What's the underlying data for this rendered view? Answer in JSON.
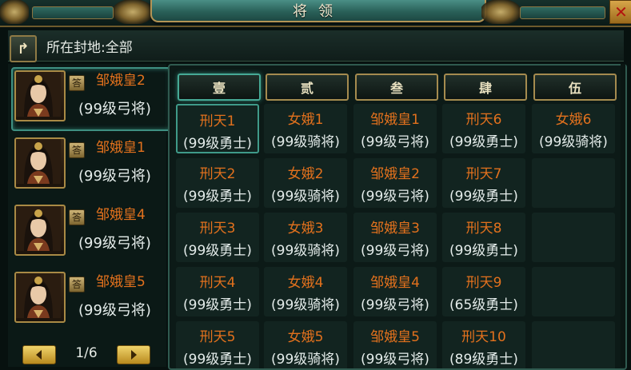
{
  "header": {
    "title": "将领"
  },
  "filter": {
    "label": "所在封地:全部"
  },
  "left_list": {
    "heroes": [
      {
        "name": "邹娥皇2",
        "level": "(99级弓将)",
        "badge": "答",
        "selected": true
      },
      {
        "name": "邹娥皇1",
        "level": "(99级弓将)",
        "badge": "答",
        "selected": false
      },
      {
        "name": "邹娥皇4",
        "level": "(99级弓将)",
        "badge": "答",
        "selected": false
      },
      {
        "name": "邹娥皇5",
        "level": "(99级弓将)",
        "badge": "答",
        "selected": false
      }
    ],
    "pager": {
      "text": "1/6"
    }
  },
  "grid": {
    "columns": [
      "壹",
      "贰",
      "叁",
      "肆",
      "伍"
    ],
    "active_column": 0,
    "rows": [
      [
        {
          "name": "刑天1",
          "level": "(99级勇士)"
        },
        {
          "name": "女娥1",
          "level": "(99级骑将)"
        },
        {
          "name": "邹娥皇1",
          "level": "(99级弓将)"
        },
        {
          "name": "刑天6",
          "level": "(99级勇士)"
        },
        {
          "name": "女娥6",
          "level": "(99级骑将)"
        }
      ],
      [
        {
          "name": "刑天2",
          "level": "(99级勇士)"
        },
        {
          "name": "女娥2",
          "level": "(99级骑将)"
        },
        {
          "name": "邹娥皇2",
          "level": "(99级弓将)"
        },
        {
          "name": "刑天7",
          "level": "(99级勇士)"
        },
        {
          "name": "",
          "level": ""
        }
      ],
      [
        {
          "name": "刑天3",
          "level": "(99级勇士)"
        },
        {
          "name": "女娥3",
          "level": "(99级骑将)"
        },
        {
          "name": "邹娥皇3",
          "level": "(99级弓将)"
        },
        {
          "name": "刑天8",
          "level": "(99级勇士)"
        },
        {
          "name": "",
          "level": ""
        }
      ],
      [
        {
          "name": "刑天4",
          "level": "(99级勇士)"
        },
        {
          "name": "女娥4",
          "level": "(99级骑将)"
        },
        {
          "name": "邹娥皇4",
          "level": "(99级弓将)"
        },
        {
          "name": "刑天9",
          "level": "(65级勇士)"
        },
        {
          "name": "",
          "level": ""
        }
      ],
      [
        {
          "name": "刑天5",
          "level": "(99级勇士)"
        },
        {
          "name": "女娥5",
          "level": "(99级骑将)"
        },
        {
          "name": "邹娥皇5",
          "level": "(99级弓将)"
        },
        {
          "name": "刑天10",
          "level": "(89级勇士)"
        },
        {
          "name": "",
          "level": ""
        }
      ]
    ]
  },
  "colors": {
    "name": "#e2711d",
    "text": "#e4ecea",
    "accent": "#3f9a89",
    "gold": "#a58b4f"
  },
  "icons": {
    "back": "back-arrow-icon",
    "close": "close-icon",
    "prev": "left-arrow-icon",
    "next": "right-arrow-icon"
  }
}
